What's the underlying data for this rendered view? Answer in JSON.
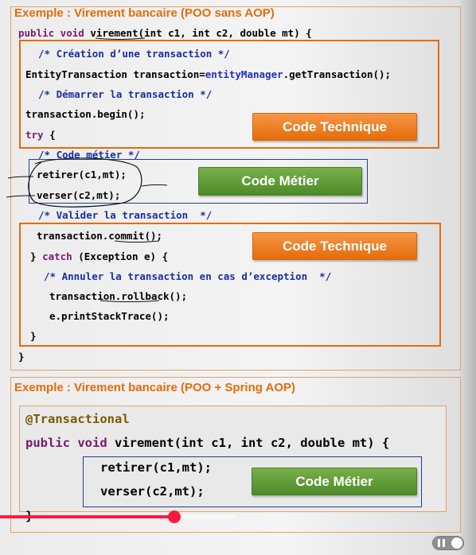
{
  "slide": {
    "section1_title": "Exemple : Virement bancaire (POO sans AOP)",
    "section2_title": "Exemple : Virement bancaire (POO + Spring AOP)",
    "code1": {
      "sig_kw": "public void ",
      "sig_name": "virement",
      "sig_rest": "(int c1, int c2, double mt) {",
      "comment_create": "/* Création d’une transaction */",
      "tx_decl_pre": "EntityTransaction transaction=",
      "tx_decl_mem": "entityManager",
      "tx_decl_post": ".getTransaction();",
      "comment_start": "/* Démarrer la transaction */",
      "tx_begin": "transaction.begin();",
      "try_kw": "try",
      "try_brace": " {",
      "comment_business": "/* Code métier */",
      "retirer": "retirer(c1,mt);",
      "verser": "verser(c2,mt);",
      "comment_validate": "/* Valider la transaction  */",
      "commit": "transaction.commit();",
      "catch_pre": "} ",
      "catch_kw": "catch",
      "catch_post": " (Exception e) {",
      "comment_rollback": "/* Annuler la transaction en cas d’exception  */",
      "rollback": "transaction.rollback();",
      "print_stack": "e.printStackTrace();",
      "close_catch": "}",
      "close_method": "}"
    },
    "code2": {
      "annotation": "@Transactional",
      "sig_kw": "public void ",
      "sig_rest": "virement(int c1, int c2, double mt) {",
      "retirer": "retirer(c1,mt);",
      "verser": "verser(c2,mt);",
      "close_method": "}"
    },
    "labels": {
      "code_technique_1": "Code Technique",
      "code_metier_1": "Code Métier",
      "code_technique_2": "Code Technique",
      "code_metier_2": "Code Métier"
    }
  },
  "player": {
    "progress_fraction": 0.367,
    "pause_icon": "pause-icon"
  },
  "colors": {
    "accent_orange": "#e46c0a",
    "accent_green": "#4f8a2a",
    "frame_blue": "#1f3d99",
    "progress_red": "#ff1744"
  }
}
